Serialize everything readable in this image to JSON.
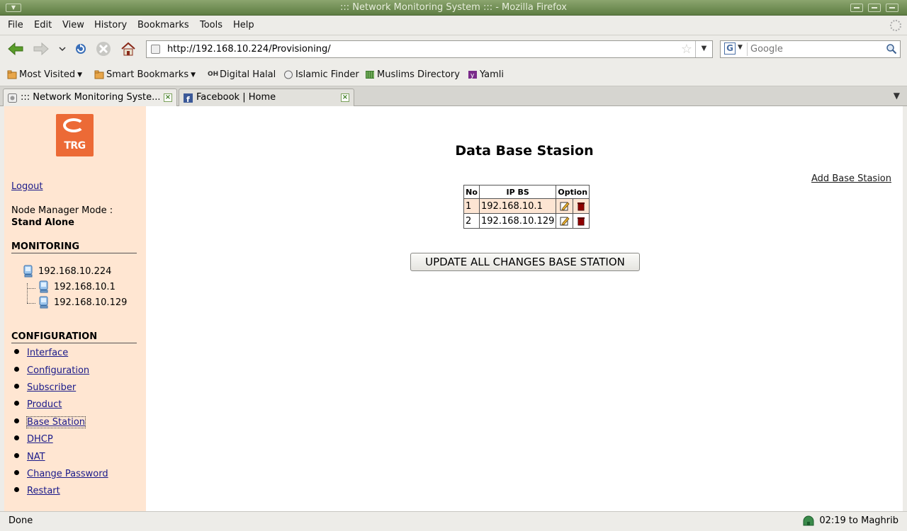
{
  "window": {
    "title": "::: Network Monitoring System ::: - Mozilla Firefox"
  },
  "menubar": {
    "items": [
      "File",
      "Edit",
      "View",
      "History",
      "Bookmarks",
      "Tools",
      "Help"
    ]
  },
  "navbar": {
    "url": "http://192.168.10.224/Provisioning/",
    "search_placeholder": "Google"
  },
  "bookmarks": [
    "Most Visited",
    "Smart Bookmarks",
    "Digital Halal",
    "Islamic Finder",
    "Muslims Directory",
    "Yamli"
  ],
  "tabs": [
    {
      "label": "::: Network Monitoring Syste...",
      "active": true
    },
    {
      "label": "Facebook | Home",
      "active": false
    }
  ],
  "sidebar": {
    "logo_text": "TRG",
    "logout": "Logout",
    "mode_label": "Node Manager Mode :",
    "mode_value": "Stand Alone",
    "monitoring_heading": "MONITORING",
    "tree": {
      "root": "192.168.10.224",
      "children": [
        "192.168.10.1",
        "192.168.10.129"
      ]
    },
    "configuration_heading": "CONFIGURATION",
    "config_links": [
      "Interface",
      "Configuration",
      "Subscriber",
      "Product",
      "Base Station",
      "DHCP",
      "NAT",
      "Change Password",
      "Restart"
    ]
  },
  "main": {
    "title": "Data Base Stasion",
    "add_link": "Add Base Stasion",
    "table": {
      "headers": [
        "No",
        "IP BS",
        "Option"
      ],
      "rows": [
        {
          "no": "1",
          "ip": "192.168.10.1"
        },
        {
          "no": "2",
          "ip": "192.168.10.129"
        }
      ]
    },
    "update_button": "UPDATE ALL CHANGES BASE STATION"
  },
  "statusbar": {
    "status": "Done",
    "prayer": "02:19 to Maghrib"
  }
}
